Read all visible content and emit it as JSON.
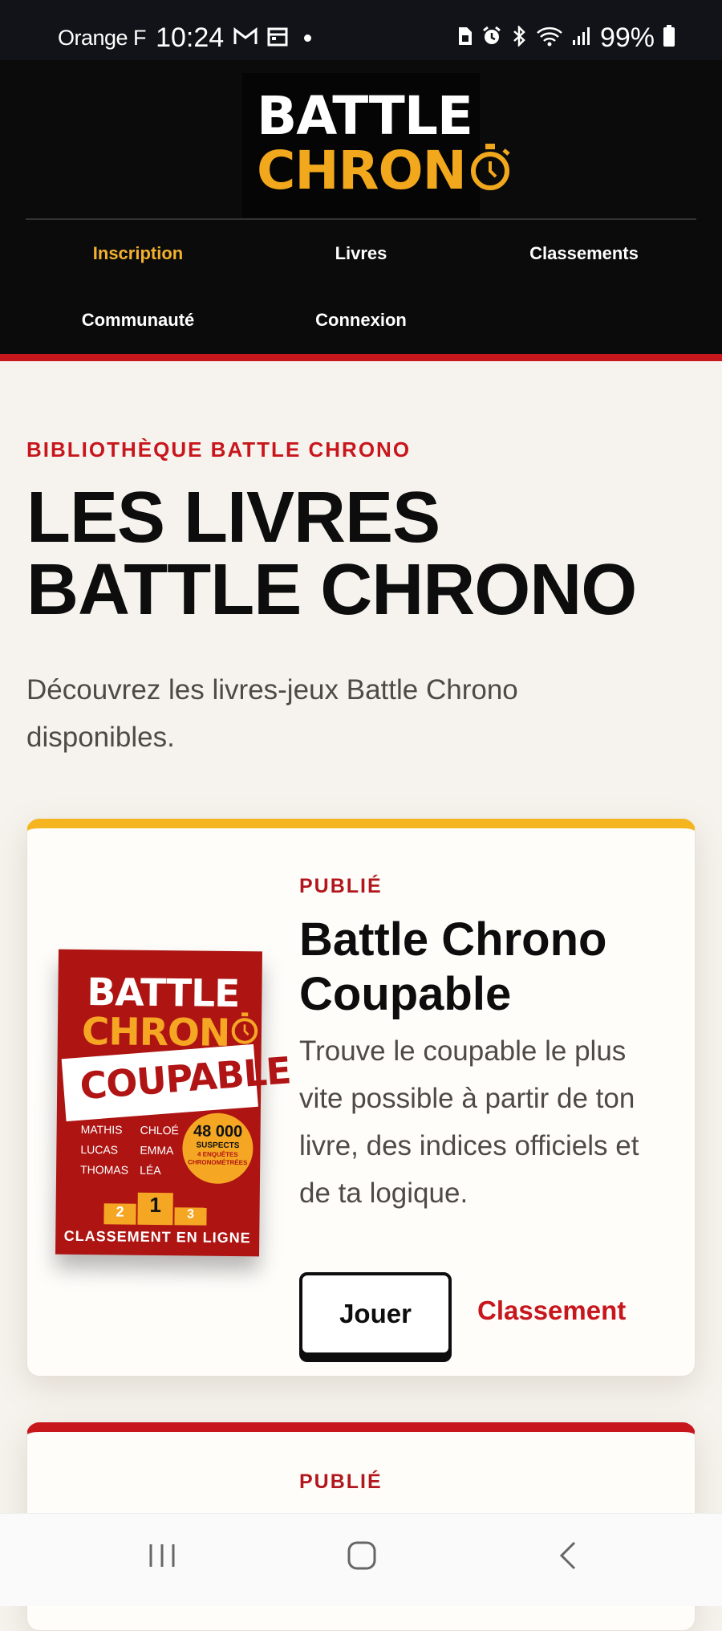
{
  "status_bar": {
    "carrier": "Orange F",
    "time": "10:24",
    "battery": "99%"
  },
  "logo": {
    "line1": "BATTLE",
    "line2": "CHRON"
  },
  "nav": [
    {
      "label": "Inscription",
      "active": true
    },
    {
      "label": "Livres",
      "active": false
    },
    {
      "label": "Classements",
      "active": false
    },
    {
      "label": "Communauté",
      "active": false
    },
    {
      "label": "Connexion",
      "active": false
    }
  ],
  "main": {
    "eyebrow": "BIBLIOTHÈQUE BATTLE CHRONO",
    "title_line1": "LES LIVRES",
    "title_line2": "BATTLE CHRONO",
    "intro": "Découvrez les livres-jeux Battle Chrono disponibles."
  },
  "books": [
    {
      "status": "PUBLIÉ",
      "title": "Battle Chrono Coupable",
      "description": "Trouve le coupable le plus vite possible à partir de ton livre, des indices officiels et de ta logique.",
      "play_label": "Jouer",
      "ranking_label": "Classement",
      "cover": {
        "title1": "BATTLE",
        "title2": "CHRON",
        "banner": "COUPABLE",
        "names_col1": [
          "MATHIS",
          "LUCAS",
          "THOMAS"
        ],
        "names_col2": [
          "CHLOÉ",
          "EMMA",
          "LÉA"
        ],
        "badge_number": "48 000",
        "badge_line1": "SUSPECTS",
        "badge_line2": "4 ENQUÊTES",
        "badge_line3": "CHRONOMÉTRÉES",
        "podium": [
          "2",
          "1",
          "3"
        ],
        "footer": "CLASSEMENT EN LIGNE"
      }
    },
    {
      "status": "PUBLIÉ"
    }
  ],
  "colors": {
    "accent_red": "#c8161d",
    "accent_gold": "#f2a81d",
    "header_bg": "#0b0b0b",
    "page_bg": "#f6f3ee"
  },
  "icons": [
    "gmail-icon",
    "calendar-icon",
    "sim-icon",
    "alarm-icon",
    "bluetooth-icon",
    "wifi-icon",
    "signal-icon",
    "battery-icon",
    "stopwatch-icon",
    "recents-icon",
    "home-icon",
    "back-icon"
  ]
}
